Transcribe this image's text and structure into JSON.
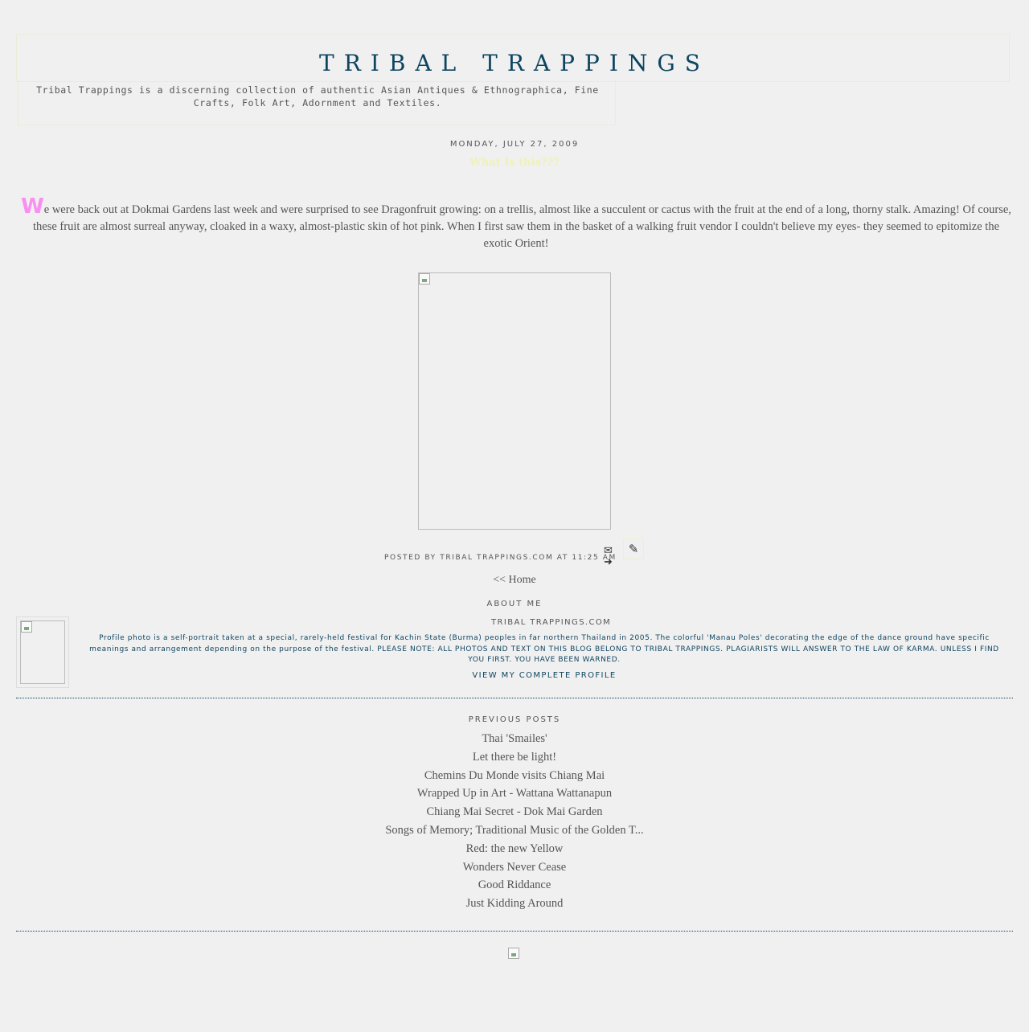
{
  "header": {
    "title": "TRIBAL TRAPPINGS",
    "description": "Tribal Trappings is a discerning collection of authentic Asian Antiques & Ethnographica, Fine Crafts, Folk Art, Adornment and Textiles."
  },
  "post": {
    "date": "MONDAY, JULY 27, 2009",
    "title": "What Is this???",
    "dropcap": "W",
    "body": "e were back out at Dokmai Gardens last week and were surprised to see Dragonfruit growing: on a trellis, almost like a succulent or cactus with the fruit at the end of a long, thorny stalk. Amazing! Of course, these fruit are almost surreal anyway, cloaked in a waxy, almost-plastic skin of hot pink. When I first saw them in the basket of a walking fruit vendor I couldn't believe my eyes- they seemed to epitomize the exotic Orient!",
    "footer": "POSTED BY TRIBAL TRAPPINGS.COM AT 11:25 AM",
    "email_icon": "email-post-icon",
    "edit_icon": "pencil-icon"
  },
  "nav": {
    "home": "<< Home"
  },
  "about": {
    "heading": "ABOUT ME",
    "name": "TRIBAL TRAPPINGS.COM",
    "text": "Profile photo is a self-portrait taken at a special, rarely-held festival for Kachin State (Burma) peoples in far northern Thailand in 2005. The colorful 'Manau Poles' decorating the edge of the dance ground have specific meanings and arrangement depending on the purpose of the festival. PLEASE NOTE: ALL PHOTOS AND TEXT ON THIS BLOG BELONG TO TRIBAL TRAPPINGS. PLAGIARISTS WILL ANSWER TO THE LAW OF KARMA. UNLESS I FIND YOU FIRST. YOU HAVE BEEN WARNED.",
    "profile_link": "VIEW MY COMPLETE PROFILE"
  },
  "previous_posts": {
    "heading": "PREVIOUS POSTS",
    "items": [
      "Thai 'Smailes'",
      "Let there be light!",
      "Chemins Du Monde visits Chiang Mai",
      "Wrapped Up in Art - Wattana Wattanapun",
      "Chiang Mai Secret - Dok Mai Garden",
      "Songs of Memory; Traditional Music of the Golden T...",
      "Red: the new Yellow",
      "Wonders Never Cease",
      "Good Riddance",
      "Just Kidding Around"
    ]
  },
  "colors": {
    "background": "#f0f0f0",
    "title": "#0e4560",
    "text": "#555555",
    "dropcap": "#f98ff0",
    "post_title": "#eef2b8"
  }
}
